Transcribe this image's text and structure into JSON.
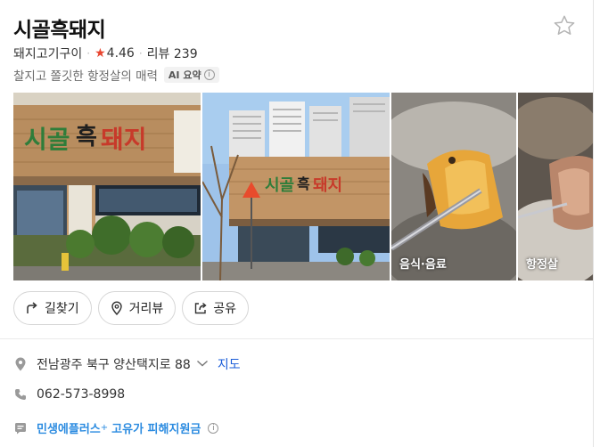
{
  "place": {
    "name": "시골흑돼지",
    "category": "돼지고기구이",
    "rating": "4.46",
    "review_label": "리뷰 239",
    "summary": "찰지고 쫄깃한 항정살의 매력",
    "ai_badge": "AI 요약",
    "info_glyph": "i"
  },
  "photos": [
    {
      "label": ""
    },
    {
      "label": ""
    },
    {
      "label": "음식·음료"
    },
    {
      "label": "항정살"
    }
  ],
  "actions": {
    "directions": "길찾기",
    "street_view": "거리뷰",
    "share": "공유"
  },
  "details": {
    "address": "전남광주 북구 양산택지로 88",
    "map_link": "지도",
    "phone": "062-573-8998",
    "promo_brand": "민생에플러스",
    "promo_plus": "+",
    "promo_text": "고유가 피해지원금"
  },
  "colors": {
    "accent_star": "#e8452f",
    "link": "#1a5cd8",
    "promo": "#2b8be0"
  }
}
